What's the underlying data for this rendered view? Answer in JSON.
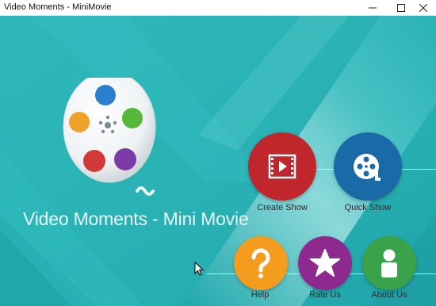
{
  "window": {
    "title": "Video Moments - MiniMovie",
    "controls": [
      "minimize",
      "maximize",
      "close"
    ]
  },
  "app": {
    "title": "Video Moments - Mini Movie"
  },
  "buttons": [
    {
      "id": "create_show",
      "label": "Create Show",
      "color": "#c0272d",
      "icon": "film-play-icon"
    },
    {
      "id": "quick_show",
      "label": "Quick  Show",
      "color": "#1a6aa8",
      "icon": "film-reel-icon"
    },
    {
      "id": "help",
      "label": "Help",
      "color": "#f39c1e",
      "icon": "question-icon"
    },
    {
      "id": "rate_us",
      "label": "Rate Us",
      "color": "#8e2a8f",
      "icon": "star-icon"
    },
    {
      "id": "about_us",
      "label": "About Us",
      "color": "#3aa24a",
      "icon": "person-icon"
    }
  ],
  "colors": {
    "background_teal": "#2ab3b6",
    "background_light": "#86d8d8"
  }
}
